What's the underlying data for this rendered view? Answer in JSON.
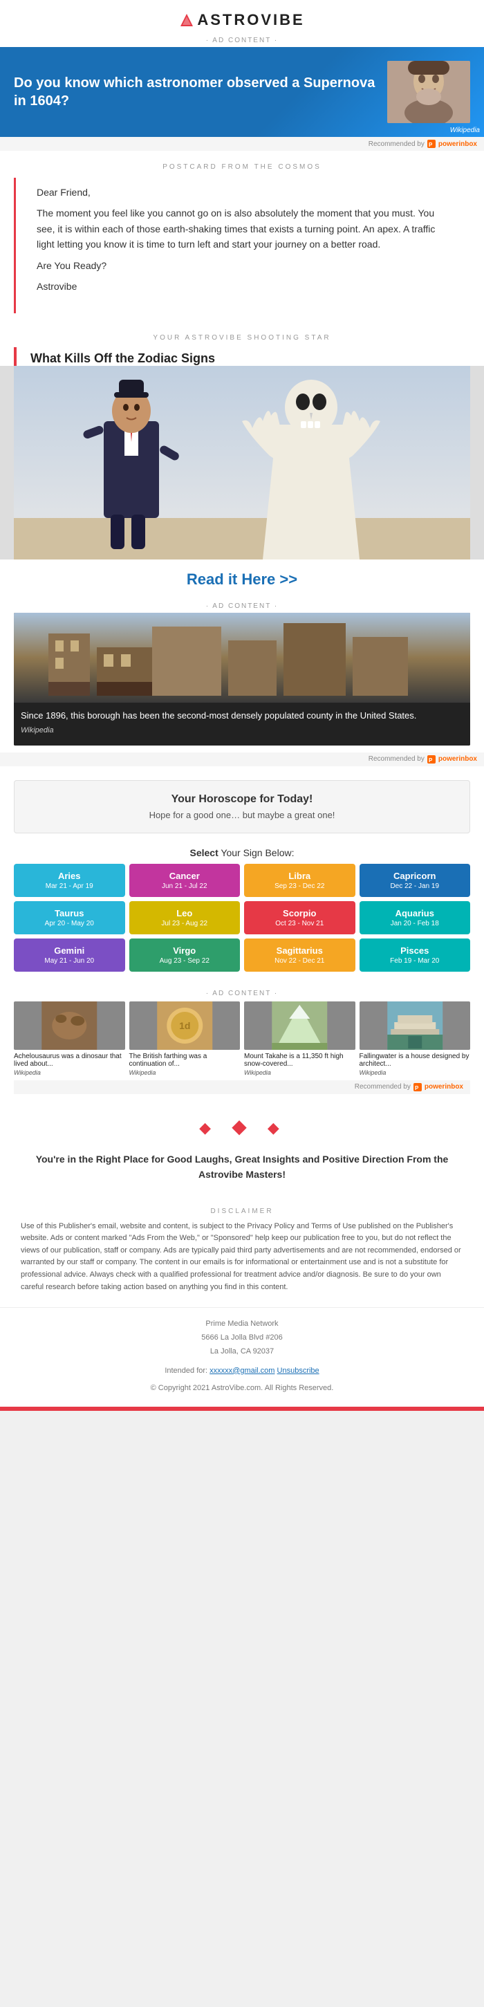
{
  "header": {
    "logo_icon": "▲",
    "logo_text": "ASTROVIBE"
  },
  "ad1": {
    "label": "· AD CONTENT ·",
    "text": "Do you know which astronomer observed a Supernova in 1604?",
    "wikipedia_badge": "Wikipedia",
    "recommended_by": "Recommended by",
    "powerinbox": "powerinbox"
  },
  "postcard": {
    "section_label": "POSTCARD FROM THE COSMOS",
    "lines": [
      "Dear Friend,",
      "The moment you feel like you cannot go on is also absolutely the moment that you must. You see, it is within each of those earth-shaking times that exists a turning point. An apex. A traffic light letting you know it is time to turn left and start your journey on a better road.",
      "Are You Ready?",
      "Astrovibe"
    ]
  },
  "shooting_star": {
    "section_label": "YOUR ASTROVIBE SHOOTING STAR",
    "title": "What Kills Off the Zodiac Signs",
    "read_link": "Read it Here >>"
  },
  "ad2": {
    "label": "· AD CONTENT ·",
    "caption": "Since 1896, this borough has been the second-most densely populated county in the United States.",
    "source": "Wikipedia",
    "recommended_by": "Recommended by",
    "powerinbox": "powerinbox"
  },
  "horoscope": {
    "title": "Your Horoscope for Today!",
    "subtitle": "Hope for a good one… but maybe a great one!"
  },
  "sign_select": {
    "label": "Select",
    "label_suffix": " Your Sign Below:",
    "signs": [
      {
        "name": "Aries",
        "dates": "Mar 21 - Apr 19",
        "color": "cyan"
      },
      {
        "name": "Cancer",
        "dates": "Jun 21 - Jul 22",
        "color": "magenta"
      },
      {
        "name": "Libra",
        "dates": "Sep 23 - Dec 22",
        "color": "orange"
      },
      {
        "name": "Capricorn",
        "dates": "Dec 22 - Jan 19",
        "color": "capricorn-blue"
      },
      {
        "name": "Taurus",
        "dates": "Apr 20 - May 20",
        "color": "cyan"
      },
      {
        "name": "Leo",
        "dates": "Jul 23 - Aug 22",
        "color": "yellow"
      },
      {
        "name": "Scorpio",
        "dates": "Oct 23 - Nov 21",
        "color": "red-sign"
      },
      {
        "name": "Aquarius",
        "dates": "Jan 20 - Feb 18",
        "color": "aquarius-teal"
      },
      {
        "name": "Gemini",
        "dates": "May 21 - Jun 20",
        "color": "purple"
      },
      {
        "name": "Virgo",
        "dates": "Aug 23 - Sep 22",
        "color": "green"
      },
      {
        "name": "Sagittarius",
        "dates": "Nov 22 - Dec 21",
        "color": "sagittarius-orange"
      },
      {
        "name": "Pisces",
        "dates": "Feb 19 - Mar 20",
        "color": "pisces-teal"
      }
    ]
  },
  "ad_row": {
    "label": "· AD CONTENT ·",
    "items": [
      {
        "title": "Achelousaurus was a dinosaur that lived about...",
        "source": "Wikipedia"
      },
      {
        "title": "The British farthing was a continuation of...",
        "source": "Wikipedia"
      },
      {
        "title": "Mount Takahe is a 11,350 ft high snow-covered...",
        "source": "Wikipedia"
      },
      {
        "title": "Fallingwater is a house designed by architect...",
        "source": "Wikipedia"
      }
    ],
    "recommended_by": "Recommended by",
    "powerinbox": "powerinbox"
  },
  "diamonds": "◆  ◆  ◆",
  "promo": {
    "text_bold": "You're in the Right Place for Good Laughs, Great Insights and Positive Direction From the Astrovibe Masters!"
  },
  "disclaimer": {
    "label": "DISCLAIMER",
    "text": "Use of this Publisher's email, website and content, is subject to the Privacy Policy and Terms of Use published on the Publisher's website. Ads or content marked \"Ads From the Web,\" or \"Sponsored\" help keep our publication free to you, but do not reflect the views of our publication, staff or company. Ads are typically paid third party advertisements and are not recommended, endorsed or warranted by our staff or company. The content in our emails is for informational or entertainment use and is not a substitute for professional advice. Always check with a qualified professional for treatment advice and/or diagnosis. Be sure to do your own careful research before taking action based on anything you find in this content."
  },
  "footer": {
    "company": "Prime Media Network",
    "address_line1": "5666 La Jolla Blvd #206",
    "address_line2": "La Jolla, CA 92037",
    "intended_label": "Intended for:",
    "email": "xxxxxx@gmail.com",
    "unsubscribe": "Unsubscribe",
    "copyright": "© Copyright 2021 AstroVibe.com. All Rights Reserved."
  },
  "ad_item_colors": [
    "#8a6a4a",
    "#c8a060",
    "#a0b888",
    "#78b0c0"
  ]
}
